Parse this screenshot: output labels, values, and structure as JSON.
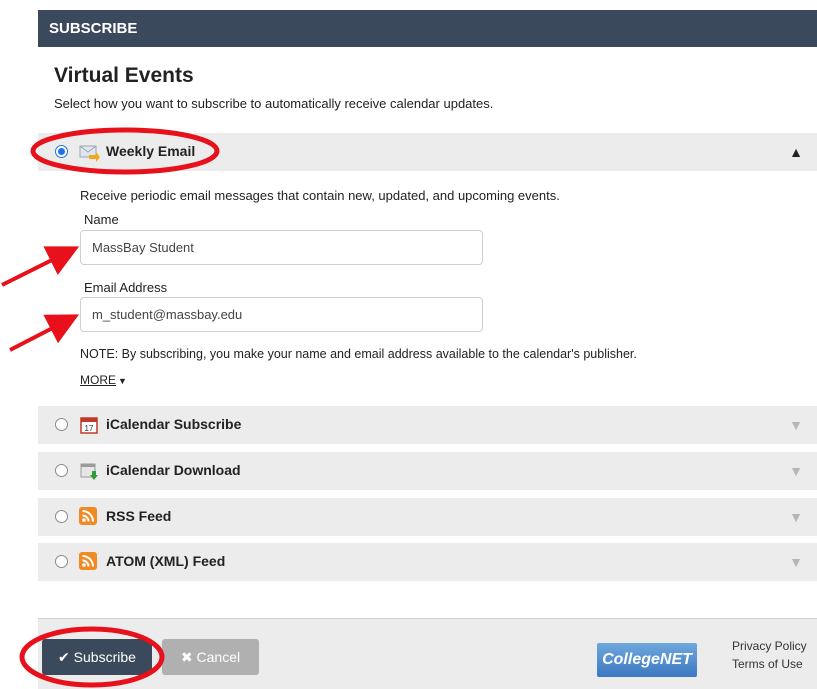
{
  "header": {
    "title": "SUBSCRIBE"
  },
  "page": {
    "heading": "Virtual Events",
    "subtext": "Select how you want to subscribe to automatically receive calendar updates."
  },
  "options": [
    {
      "label": "Weekly Email",
      "icon": "email-icon",
      "selected": true,
      "expanded": true
    },
    {
      "label": "iCalendar Subscribe",
      "icon": "calendar-icon",
      "selected": false,
      "expanded": false
    },
    {
      "label": "iCalendar Download",
      "icon": "calendar-download-icon",
      "selected": false,
      "expanded": false
    },
    {
      "label": "RSS Feed",
      "icon": "rss-icon",
      "selected": false,
      "expanded": false
    },
    {
      "label": "ATOM (XML) Feed",
      "icon": "rss-icon",
      "selected": false,
      "expanded": false
    }
  ],
  "email_panel": {
    "description": "Receive periodic email messages that contain new, updated, and upcoming events.",
    "name_label": "Name",
    "name_value": "MassBay Student",
    "email_label": "Email Address",
    "email_value": "m_student@massbay.edu",
    "note": "NOTE: By subscribing, you make your name and email address available to the calendar's publisher.",
    "more_label": "MORE"
  },
  "footer": {
    "subscribe_label": "Subscribe",
    "cancel_label": "Cancel",
    "logo_text": "CollegeNET",
    "privacy_label": "Privacy Policy",
    "terms_label": "Terms of Use"
  },
  "colors": {
    "header_bg": "#3a4a5c",
    "row_bg": "#ececec",
    "accent_blue": "#1a73e8",
    "annotation_red": "#e8101a"
  }
}
